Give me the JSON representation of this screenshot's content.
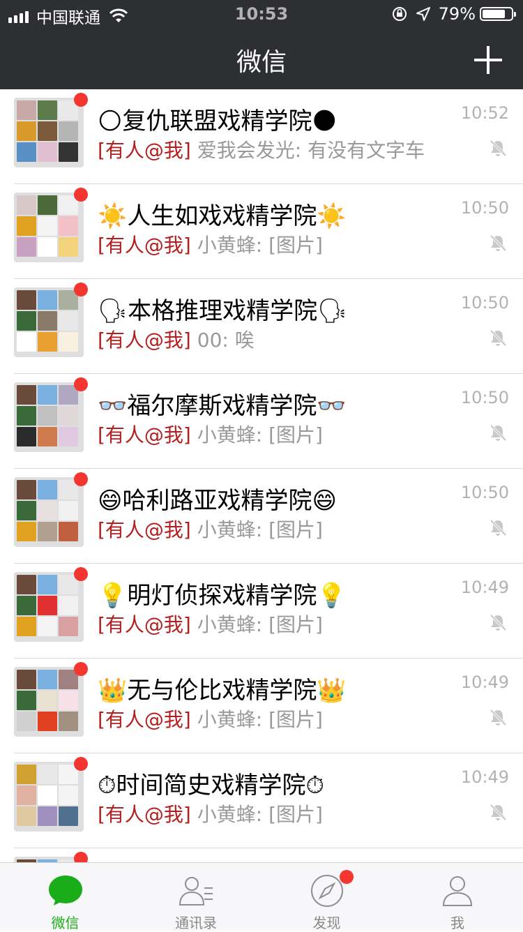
{
  "status": {
    "carrier": "中国联通",
    "time": "10:53",
    "battery_pct": "79%",
    "battery_level": 0.79
  },
  "nav": {
    "title": "微信",
    "add_icon": "plus-icon"
  },
  "chats": [
    {
      "title": "🌕复仇联盟戏精学院🌑",
      "time": "10:52",
      "mention": "[有人@我]",
      "preview": " 爱我会发光: 有没有文字车",
      "unread_dot": true,
      "muted": true
    },
    {
      "title": "☀️人生如戏戏精学院☀️",
      "time": "10:50",
      "mention": "[有人@我]",
      "preview": " 小黄蜂: [图片]",
      "unread_dot": true,
      "muted": true
    },
    {
      "title": "🗣本格推理戏精学院🗣",
      "time": "10:50",
      "mention": "[有人@我]",
      "preview": " 00: 唉",
      "unread_dot": true,
      "muted": true
    },
    {
      "title": "👓福尔摩斯戏精学院👓",
      "time": "10:50",
      "mention": "[有人@我]",
      "preview": " 小黄蜂: [图片]",
      "unread_dot": true,
      "muted": true
    },
    {
      "title": "😄哈利路亚戏精学院😄",
      "time": "10:50",
      "mention": "[有人@我]",
      "preview": " 小黄蜂: [图片]",
      "unread_dot": true,
      "muted": true
    },
    {
      "title": "💡明灯侦探戏精学院💡",
      "time": "10:49",
      "mention": "[有人@我]",
      "preview": " 小黄蜂: [图片]",
      "unread_dot": true,
      "muted": true
    },
    {
      "title": "👑无与伦比戏精学院👑",
      "time": "10:49",
      "mention": "[有人@我]",
      "preview": " 小黄蜂: [图片]",
      "unread_dot": true,
      "muted": true
    },
    {
      "title": "⏱时间简史戏精学院⏱",
      "time": "10:49",
      "mention": "[有人@我]",
      "preview": " 小黄蜂: [图片]",
      "unread_dot": true,
      "muted": true
    }
  ],
  "tabs": [
    {
      "label": "微信",
      "icon": "chat-bubble-icon",
      "active": true,
      "dot": false
    },
    {
      "label": "通讯录",
      "icon": "contacts-icon",
      "active": false,
      "dot": false
    },
    {
      "label": "发现",
      "icon": "compass-icon",
      "active": false,
      "dot": true
    },
    {
      "label": "我",
      "icon": "person-icon",
      "active": false,
      "dot": false
    }
  ],
  "colors": {
    "nav_bg": "#2e2f33",
    "mention": "#b41e1e",
    "badge": "#f43530",
    "active_tab": "#1aad19",
    "muted_text": "#999999"
  }
}
